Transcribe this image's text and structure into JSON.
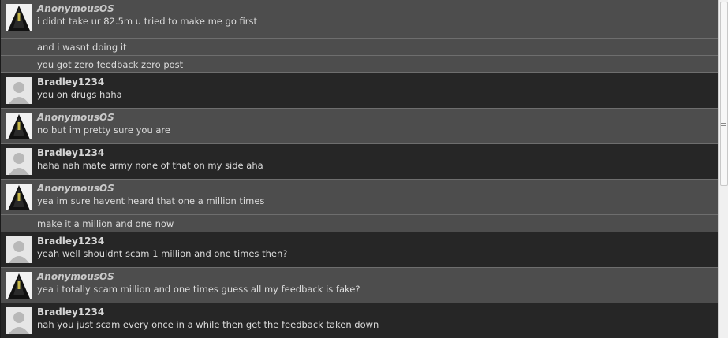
{
  "messages": [
    {
      "user": "AnonymousOS",
      "lines": [
        "i didnt take ur 82.5m u tried to make me go first",
        "and i wasnt doing it",
        "you got zero feedback zero post"
      ]
    },
    {
      "user": "Bradley1234",
      "lines": [
        "you on drugs haha"
      ]
    },
    {
      "user": "AnonymousOS",
      "lines": [
        "no but im pretty sure you are"
      ]
    },
    {
      "user": "Bradley1234",
      "lines": [
        "haha nah mate army none of that on my side aha"
      ]
    },
    {
      "user": "AnonymousOS",
      "lines": [
        "yea im sure havent heard that one a million times",
        "make it a million and one now"
      ]
    },
    {
      "user": "Bradley1234",
      "lines": [
        "yeah well shouldnt scam 1 million and one times then?"
      ]
    },
    {
      "user": "AnonymousOS",
      "lines": [
        "yea i totally scam million and one times guess all my feedback is fake?"
      ]
    },
    {
      "user": "Bradley1234",
      "lines": [
        "nah you just scam every once in a while then get the feedback taken down"
      ]
    }
  ],
  "icons": {
    "anon_avatar": "hooded-figure-avatar-icon",
    "brad_avatar": "default-user-avatar-icon",
    "scroll_grip": "scrollbar-grip-icon"
  }
}
